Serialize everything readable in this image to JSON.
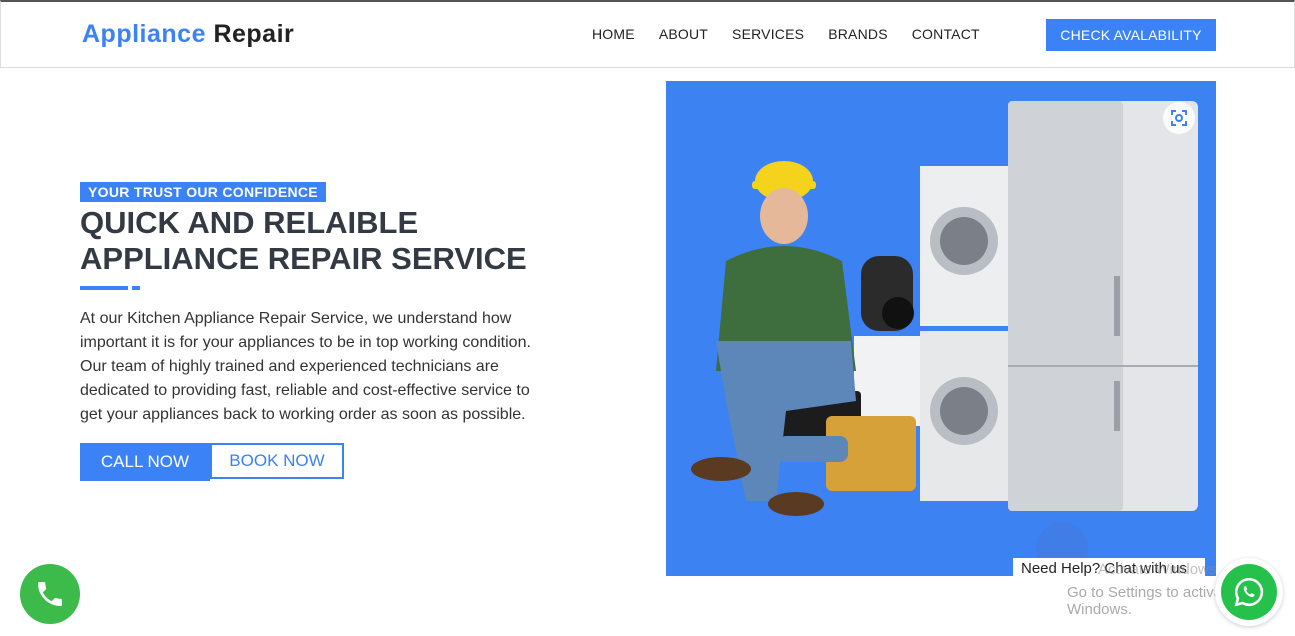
{
  "header": {
    "logo_part1": "Appliance",
    "logo_part2": "Repair",
    "nav": [
      "HOME",
      "ABOUT",
      "SERVICES",
      "BRANDS",
      "CONTACT"
    ],
    "cta_label": "CHECK AVALABILITY"
  },
  "hero": {
    "badge": "YOUR TRUST OUR CONFIDENCE",
    "title_line1": "QUICK AND RELAIBLE",
    "title_line2": "APPLIANCE REPAIR SERVICE",
    "description": "At our Kitchen Appliance Repair Service, we understand how important it is for your appliances to be in top working condition. Our team of highly trained and experienced technicians are dedicated to providing fast, reliable and cost-effective service to get your appliances back to working order as soon as possible.",
    "call_label": "CALL NOW",
    "book_label": "BOOK NOW"
  },
  "chat": {
    "bubble_text": "Need Help? Chat with us"
  },
  "overlay": {
    "watermark_line1": "Activate Windows",
    "watermark_line2": "Go to Settings to activate Windows."
  },
  "colors": {
    "accent": "#3b82f6",
    "hero_bg": "#3d82f3",
    "phone_green": "#3dbb4a",
    "whatsapp_green": "#25c14a"
  },
  "icons": [
    "scan-icon",
    "phone-icon",
    "whatsapp-icon"
  ]
}
